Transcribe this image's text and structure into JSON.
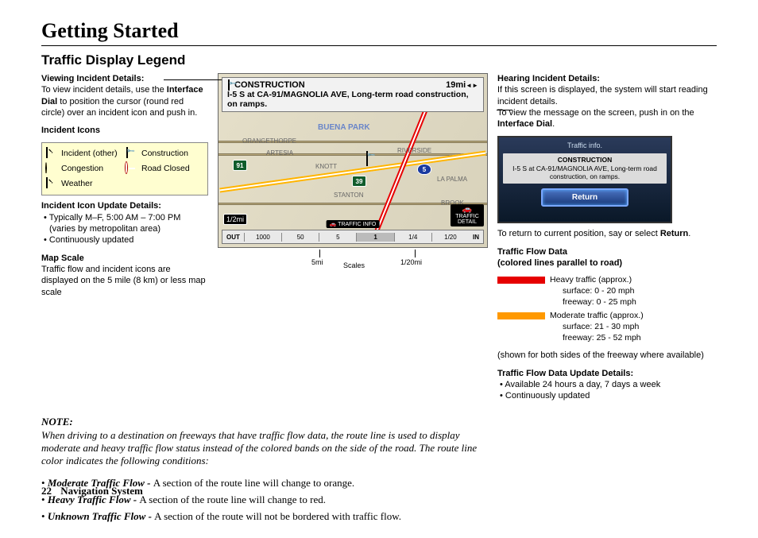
{
  "page": {
    "main_title": "Getting Started",
    "subtitle": "Traffic Display Legend",
    "page_number": "22",
    "footer_label": "Navigation System"
  },
  "col1": {
    "viewing_heading": "Viewing Incident Details:",
    "viewing_line1": "To view incident details, use the ",
    "viewing_bold": "Interface Dial",
    "viewing_line2": " to position the cursor (round red circle) over an incident icon and push in.",
    "icons_heading": "Incident Icons",
    "ic_other": "Incident (other)",
    "ic_construction": "Construction",
    "ic_congestion": "Congestion",
    "ic_road_closed": "Road Closed",
    "ic_weather": "Weather",
    "update_heading": "Incident Icon Update Details:",
    "update_b1": "Typically M–F, 5:00 AM – 7:00 PM (varies by metropolitan area)",
    "update_b2": "Continuously updated",
    "mapscale_heading": "Map Scale",
    "mapscale_text": "Traffic flow and incident icons are displayed on the 5 mile (8 km) or less map scale"
  },
  "map": {
    "banner_icon_name": "construction-icon",
    "banner_title": "CONSTRUCTION",
    "banner_dist": "19mi",
    "banner_detail": "I-5 S at CA-91/MAGNOLIA AVE, Long-term road construction, on ramps.",
    "c_buena": "BUENA PARK",
    "c_orange": "ORANGETHORPE",
    "c_artesia": "ARTESIA",
    "c_knott": "KNOTT",
    "c_riverside": "RIVERSIDE",
    "c_lapalma": "LA PALMA",
    "c_stanton": "STANTON",
    "c_brook": "BROOK",
    "shield_91": "91",
    "shield_39": "39",
    "shield_i5": "5",
    "scale_badge": "1/2mi",
    "traffic_detail_lbl": "TRAFFIC DETAIL",
    "scale_out": "OUT",
    "scale_in": "IN",
    "t1": "1000",
    "t2": "50",
    "t3": "5",
    "t4": "1",
    "t5": "1/4",
    "t6": "1/20",
    "traffic_info_lbl": "TRAFFIC INFO",
    "lbl_5mi": "5mi",
    "lbl_120mi": "1/20mi",
    "lbl_scales": "Scales"
  },
  "col3": {
    "hearing_heading": "Hearing Incident Details:",
    "hearing_text1": "If this screen is displayed, the system will start reading incident details.",
    "hearing_text2a": "To view the message on the screen, push in on the ",
    "hearing_bold": "Interface Dial",
    "hearing_text2b": ".",
    "popup_title": "Traffic info.",
    "popup_sub": "CONSTRUCTION",
    "popup_msg": "I-5 S at CA-91/MAGNOLIA AVE, Long-term road construction, on ramps.",
    "popup_return": "Return",
    "return_text_a": "To return to current position, say or select ",
    "return_bold": "Return",
    "return_text_b": ".",
    "flow_heading1": "Traffic Flow Data",
    "flow_heading2": "(colored lines parallel to road)",
    "heavy_label": "Heavy traffic (approx.)",
    "heavy_s": "surface: 0 - 20 mph",
    "heavy_f": "freeway: 0 - 25 mph",
    "mod_label": "Moderate traffic (approx.)",
    "mod_s": "surface: 21 - 30 mph",
    "mod_f": "freeway: 25 - 52 mph",
    "shown_text": "(shown for both sides of the freeway where available)",
    "flow_update_heading": "Traffic Flow Data Update Details:",
    "flow_b1": "Available 24 hours a day, 7 days a week",
    "flow_b2": "Continuously updated"
  },
  "note": {
    "label": "NOTE:",
    "text": "When driving to a destination on freeways that have traffic flow data, the route line is used to display moderate and heavy traffic flow status instead of the colored bands on the side of the road. The route line color indicates the following conditions:",
    "c1_b": "Moderate Traffic Flow - ",
    "c1_t": "A section of the route line will change to orange.",
    "c2_b": "Heavy Traffic Flow - ",
    "c2_t": "A section of the route line will change to red.",
    "c3_b": "Unknown Traffic Flow - ",
    "c3_t": "A section of the route will not be bordered with traffic flow."
  }
}
